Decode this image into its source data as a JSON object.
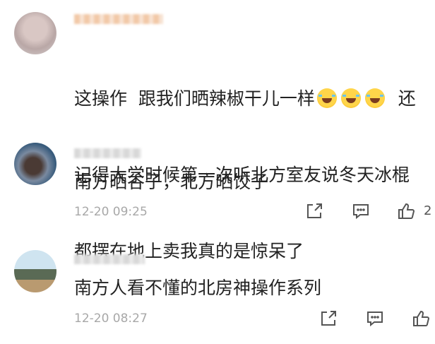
{
  "comments": [
    {
      "text_line1_a": "这操作  跟我们晒辣椒干儿一样",
      "text_line1_b": "  还",
      "text_line2": "记得大学时候第一次听北方室友说冬天冰棍",
      "text_line3": "都摆在地上卖我真的是惊呆了",
      "emojis": [
        "tears-of-joy-emoji",
        "tears-of-joy-emoji",
        "tears-of-joy-emoji"
      ]
    },
    {
      "text": "南方晒谷子，北方晒饺子",
      "timestamp": "12-20 09:25",
      "like_count": "2"
    },
    {
      "text": "南方人看不懂的北房神操作系列",
      "timestamp": "12-20 08:27"
    }
  ],
  "icons": {
    "share": "share-icon",
    "reply": "comment-icon",
    "like": "thumbs-up-icon"
  },
  "colors": {
    "text": "#222222",
    "meta": "#a8a8a8",
    "icon": "#555555"
  }
}
